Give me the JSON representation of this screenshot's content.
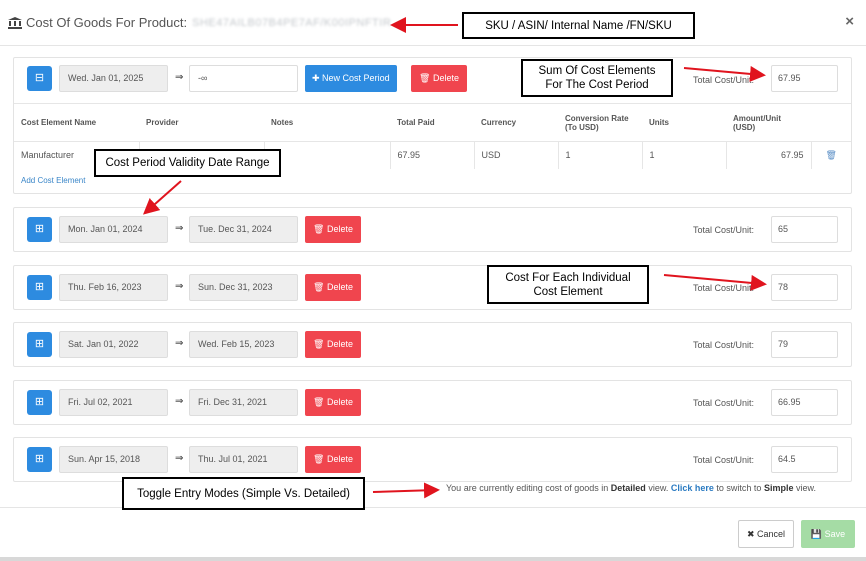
{
  "modal": {
    "title": "Cost Of Goods For Product:",
    "product_id_blurred": "SHE47AILB07B4PE7AF/K00IPNFTIR",
    "close": "×"
  },
  "labels": {
    "total_cost_unit": "Total Cost/Unit:",
    "new_cost_period": "New Cost Period",
    "delete": "Delete",
    "arrow": "⇒",
    "add_cost_element": "Add Cost Element"
  },
  "first_period": {
    "from": "Wed. Jan 01, 2025",
    "to": "-∞",
    "total": "67.95",
    "columns": [
      "Cost Element Name",
      "Provider",
      "Notes",
      "Total Paid",
      "Currency",
      "Conversion Rate (To USD)",
      "Units",
      "Amount/Unit (USD)"
    ],
    "rows": [
      {
        "name": "Manufacturer",
        "provider": "",
        "notes": "",
        "total_paid": "67.95",
        "currency": "USD",
        "rate": "1",
        "units": "1",
        "amount": "67.95"
      }
    ]
  },
  "periods": [
    {
      "from": "Mon. Jan 01, 2024",
      "to": "Tue. Dec 31, 2024",
      "total": "65"
    },
    {
      "from": "Thu. Feb 16, 2023",
      "to": "Sun. Dec 31, 2023",
      "total": "78"
    },
    {
      "from": "Sat. Jan 01, 2022",
      "to": "Wed. Feb 15, 2023",
      "total": "79"
    },
    {
      "from": "Fri. Jul 02, 2021",
      "to": "Fri. Dec 31, 2021",
      "total": "66.95"
    },
    {
      "from": "Sun. Apr 15, 2018",
      "to": "Thu. Jul 01, 2021",
      "total": "64.5"
    }
  ],
  "annotations": {
    "sku": "SKU / ASIN/ Internal Name /FN/SKU",
    "sum": "Sum Of Cost Elements For The Cost Period",
    "validity": "Cost Period Validity Date Range",
    "each": "Cost For Each Individual Cost Element",
    "toggle": "Toggle Entry Modes (Simple Vs. Detailed)"
  },
  "footer": {
    "note_prefix": "You are currently editing cost of goods in",
    "mode": "Detailed",
    "note_mid": "view.",
    "link": "Click here",
    "note_suffix": "to switch to",
    "alt_mode": "Simple",
    "note_end": "view.",
    "cancel": "Cancel",
    "save": "Save"
  },
  "colors": {
    "primary": "#2d8be0",
    "danger": "#f0454e",
    "success_disabled": "#a5dca5",
    "annotation_arrow": "#e0141e"
  }
}
